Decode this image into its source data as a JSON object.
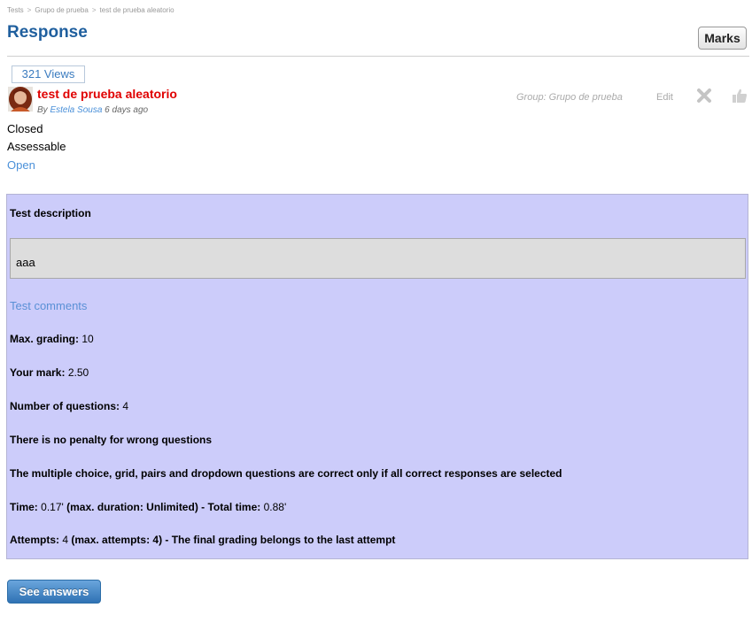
{
  "breadcrumb": {
    "items": [
      "Tests",
      "Grupo de prueba",
      "test de prueba aleatorio"
    ],
    "separator": ">"
  },
  "page": {
    "title": "Response",
    "marks_button": "Marks"
  },
  "post": {
    "views": "321 Views",
    "title": "test de prueba aleatorio",
    "by_prefix": "By",
    "author": "Estela Sousa",
    "time_ago": "6 days ago",
    "status": "Closed",
    "assessable": "Assessable",
    "open_link": "Open",
    "group_label": "Group: Grupo de prueba",
    "edit_link": "Edit"
  },
  "test": {
    "description_heading": "Test description",
    "description": "aaa",
    "comments_link": "Test comments",
    "max_grading_label": "Max. grading:",
    "max_grading_value": "10",
    "your_mark_label": "Your mark:",
    "your_mark_value": "2.50",
    "num_questions_label": "Number of questions:",
    "num_questions_value": "4",
    "penalty_text": "There is no penalty for wrong questions",
    "multiple_choice_note": "The multiple choice, grid, pairs and dropdown questions are correct only if all correct responses are selected",
    "time_label": "Time:",
    "time_value": "0.17'",
    "max_duration_label": "(max. duration: Unlimited) - Total time:",
    "total_time_value": "0.88'",
    "attempts_label": "Attempts:",
    "attempts_value": "4",
    "attempts_rest": "(max. attempts: 4) - The final grading belongs to the last attempt"
  },
  "actions": {
    "see_answers": "See answers"
  },
  "colors": {
    "title_blue": "#1f5f9e",
    "link_blue": "#4a90d9",
    "post_title_red": "#e00000",
    "panel_bg": "#ccccfa",
    "button_blue": "#2f72b4"
  },
  "icons": {
    "remove": "close-x-icon",
    "like": "thumbs-up-icon"
  }
}
